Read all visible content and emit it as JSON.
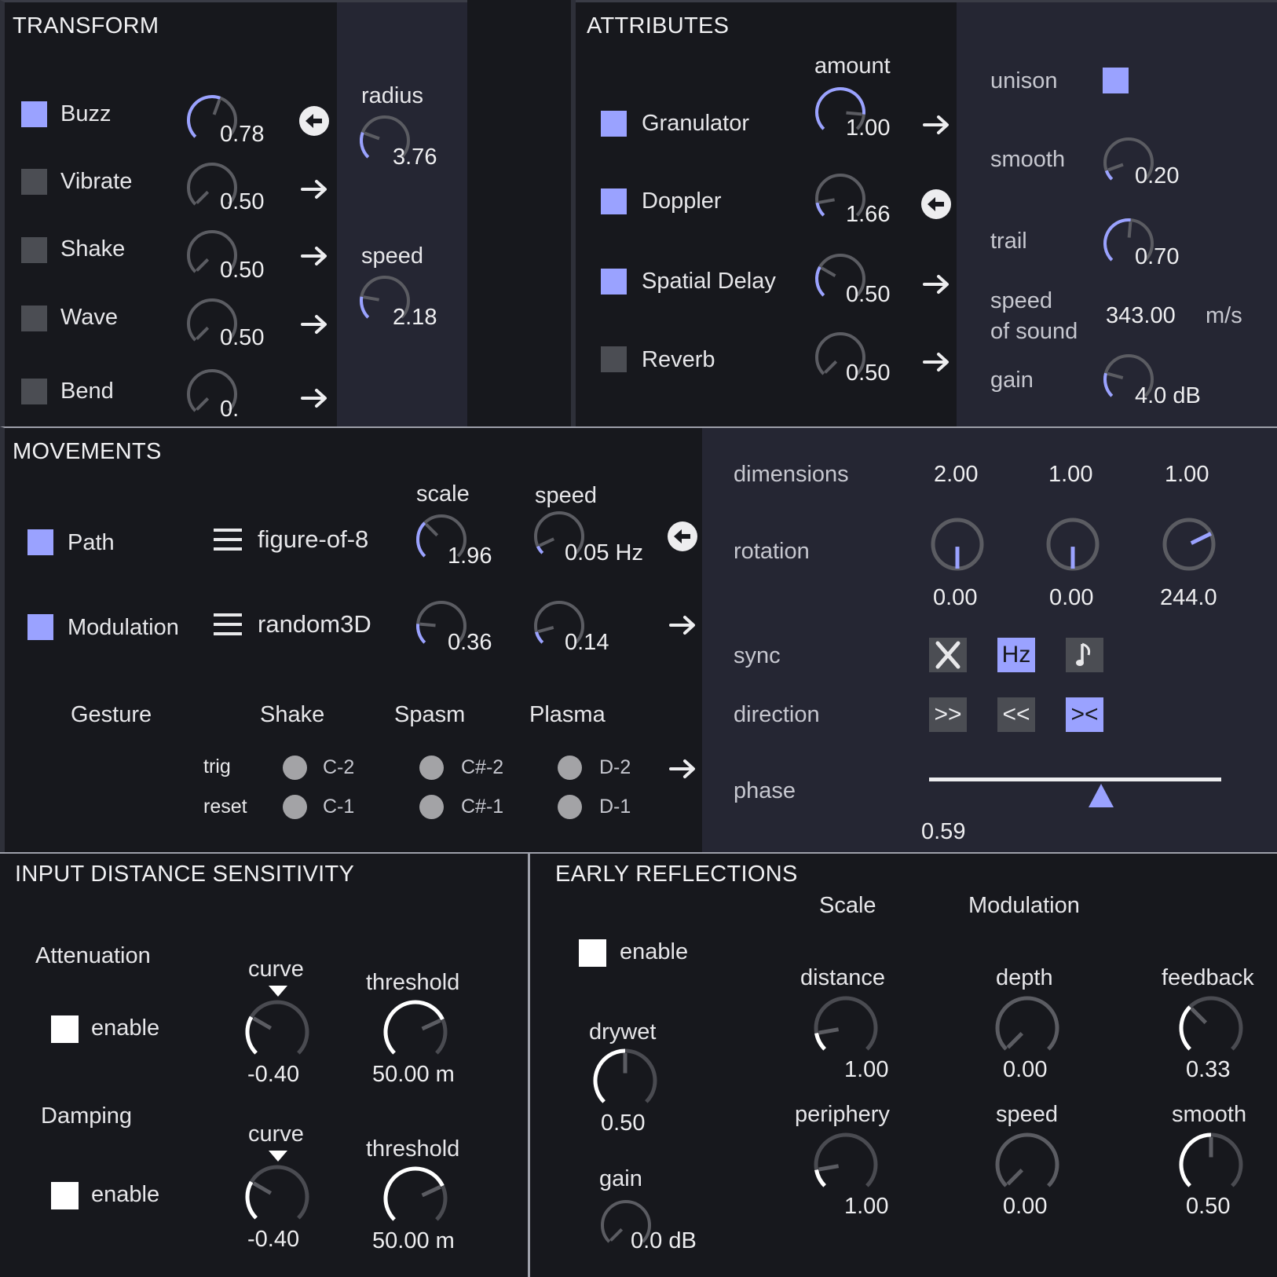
{
  "colors": {
    "accent": "#9aa2ff",
    "panel_dark": "#17181d",
    "panel_side": "#252633",
    "toggle_off": "#4b4d53"
  },
  "transform": {
    "title": "TRANSFORM",
    "rows": [
      {
        "label": "Buzz",
        "value": "0.78",
        "enabled": true,
        "fraction": 0.78
      },
      {
        "label": "Vibrate",
        "value": "0.50",
        "enabled": false,
        "fraction": 0.5
      },
      {
        "label": "Shake",
        "value": "0.50",
        "enabled": false,
        "fraction": 0.5
      },
      {
        "label": "Wave",
        "value": "0.50",
        "enabled": false,
        "fraction": 0.5
      },
      {
        "label": "Bend",
        "value": "0.",
        "enabled": false,
        "fraction": 0.5
      }
    ],
    "radius": {
      "label": "radius",
      "value": "3.76"
    },
    "speed": {
      "label": "speed",
      "value": "2.18"
    }
  },
  "attributes": {
    "title": "ATTRIBUTES",
    "amount_label": "amount",
    "rows": [
      {
        "label": "Granulator",
        "value": "1.00",
        "enabled": true
      },
      {
        "label": "Doppler",
        "value": "1.66",
        "enabled": true
      },
      {
        "label": "Spatial Delay",
        "value": "0.50",
        "enabled": true
      },
      {
        "label": "Reverb",
        "value": "0.50",
        "enabled": false
      }
    ],
    "unison": {
      "label": "unison",
      "enabled": true
    },
    "smooth": {
      "label": "smooth",
      "value": "0.20"
    },
    "trail": {
      "label": "trail",
      "value": "0.70"
    },
    "speed_of_sound": {
      "label_line1": "speed",
      "label_line2": "of sound",
      "value": "343.00",
      "unit": "m/s"
    },
    "gain": {
      "label": "gain",
      "value": "4.0 dB"
    }
  },
  "movements": {
    "title": "MOVEMENTS",
    "scale_label": "scale",
    "speed_label": "speed",
    "path": {
      "label": "Path",
      "mode": "figure-of-8",
      "scale": "1.96",
      "speed": "0.05 Hz"
    },
    "modulation": {
      "label": "Modulation",
      "mode": "random3D",
      "scale": "0.36",
      "speed": "0.14"
    },
    "gesture": {
      "label": "Gesture",
      "trig_label": "trig",
      "reset_label": "reset",
      "columns": [
        {
          "name": "Shake",
          "trig": "C-2",
          "reset": "C-1"
        },
        {
          "name": "Spasm",
          "trig": "C#-2",
          "reset": "C#-1"
        },
        {
          "name": "Plasma",
          "trig": "D-2",
          "reset": "D-1"
        }
      ]
    }
  },
  "movement_settings": {
    "dimensions": {
      "label": "dimensions",
      "values": [
        "2.00",
        "1.00",
        "1.00"
      ]
    },
    "rotation": {
      "label": "rotation",
      "values": [
        "0.00",
        "0.00",
        "244.0"
      ]
    },
    "sync": {
      "label": "sync",
      "buttons": [
        "✕",
        "Hz",
        "♪"
      ]
    },
    "direction": {
      "label": "direction",
      "buttons": [
        ">>",
        "<<",
        "><"
      ]
    },
    "phase": {
      "label": "phase",
      "value": "0.59",
      "fraction": 0.59
    }
  },
  "input_distance": {
    "title": "INPUT DISTANCE SENSITIVITY",
    "attenuation": {
      "label": "Attenuation",
      "enable_label": "enable",
      "curve_label": "curve",
      "curve": "-0.40",
      "threshold_label": "threshold",
      "threshold": "50.00 m"
    },
    "damping": {
      "label": "Damping",
      "enable_label": "enable",
      "curve_label": "curve",
      "curve": "-0.40",
      "threshold_label": "threshold",
      "threshold": "50.00 m"
    }
  },
  "early_reflections": {
    "title": "EARLY REFLECTIONS",
    "scale_header": "Scale",
    "modulation_header": "Modulation",
    "enable_label": "enable",
    "drywet": {
      "label": "drywet",
      "value": "0.50"
    },
    "gain": {
      "label": "gain",
      "value": "0.0 dB"
    },
    "distance": {
      "label": "distance",
      "value": "1.00"
    },
    "periphery": {
      "label": "periphery",
      "value": "1.00"
    },
    "depth": {
      "label": "depth",
      "value": "0.00"
    },
    "speed": {
      "label": "speed",
      "value": "0.00"
    },
    "feedback": {
      "label": "feedback",
      "value": "0.33"
    },
    "smooth": {
      "label": "smooth",
      "value": "0.50"
    }
  }
}
